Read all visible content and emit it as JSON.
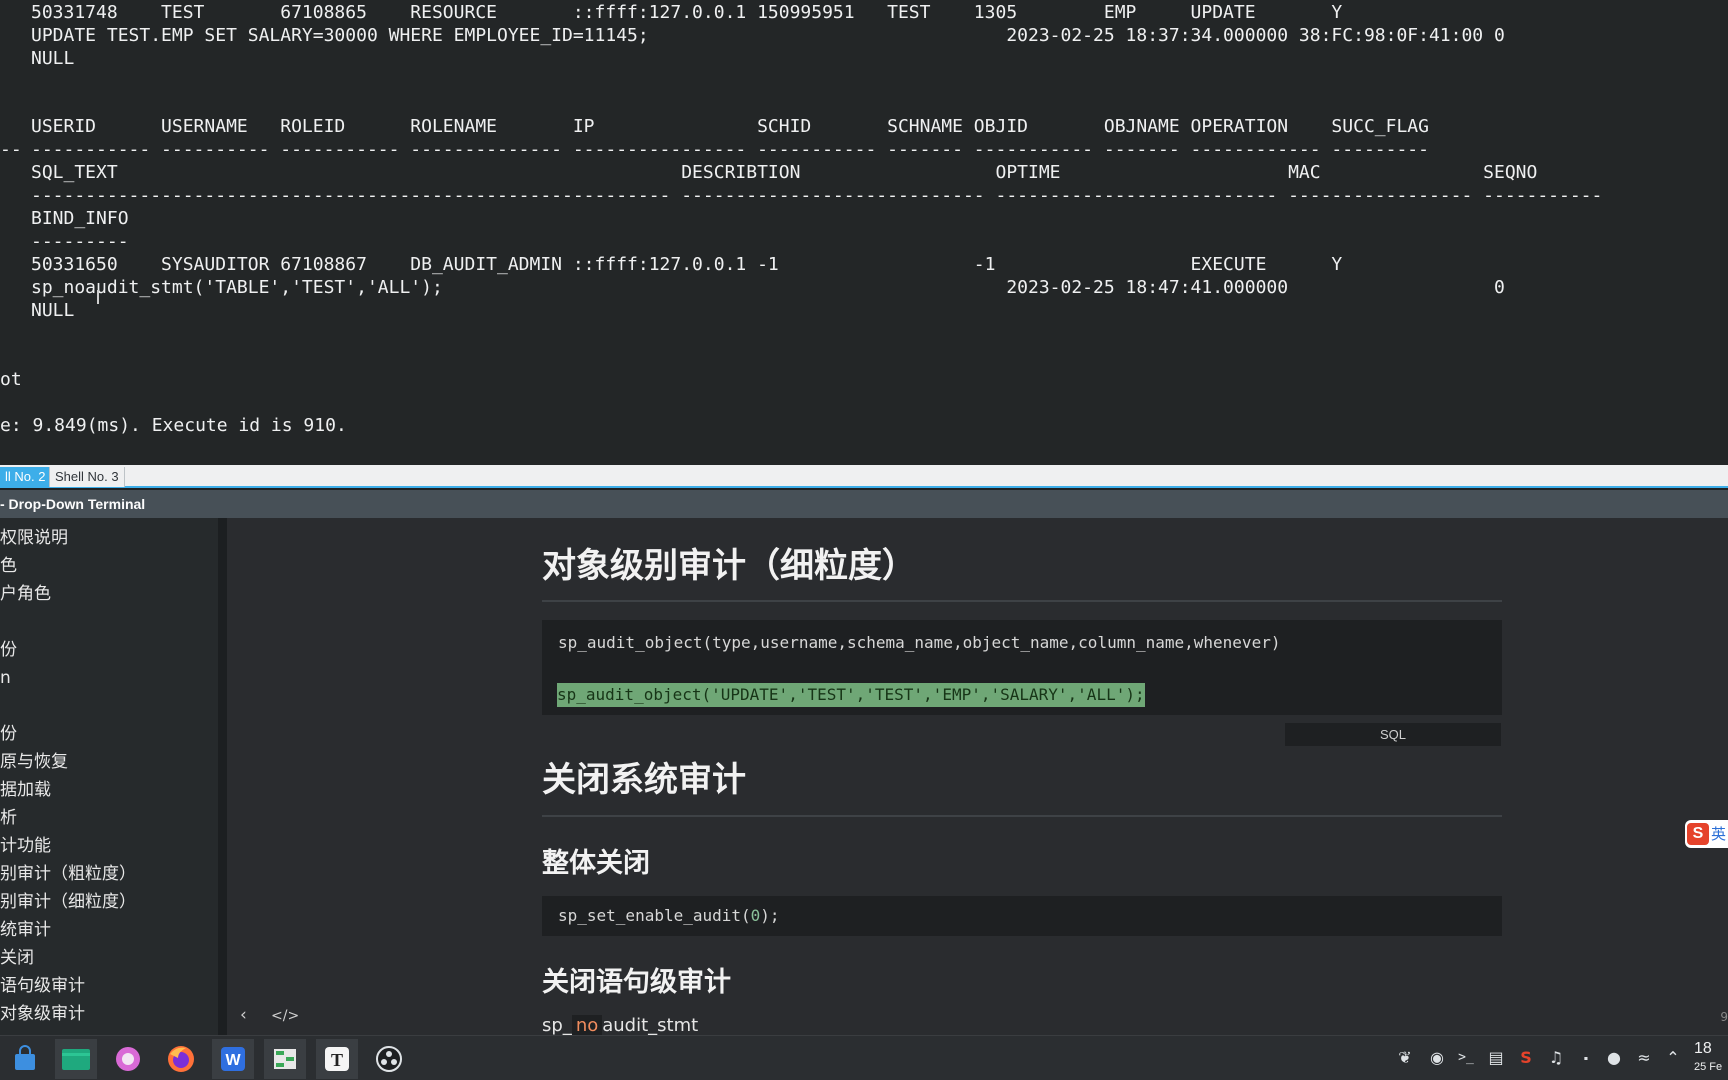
{
  "terminal": {
    "lines": [
      "50331748    TEST       67108865    RESOURCE       ::ffff:127.0.0.1 150995951   TEST    1305        EMP     UPDATE       Y",
      "UPDATE TEST.EMP SET SALARY=30000 WHERE EMPLOYEE_ID=11145;                                 2023-02-25 18:37:34.000000 38:FC:98:0F:41:00 0",
      "NULL",
      "USERID      USERNAME   ROLEID      ROLENAME       IP               SCHID       SCHNAME OBJID       OBJNAME OPERATION    SUCC_FLAG",
      "----------- ---------- ----------- -------------- ---------------- ----------- ------- ----------- ------- ------------ ---------",
      "SQL_TEXT                                                    DESCRIBTION                  OPTIME                     MAC               SEQNO",
      "----------------------------------------------------------- ---------------------------- -------------------------- ----------------- -----------",
      "BIND_INFO",
      "---------",
      "50331650    SYSAUDITOR 67108867    DB_AUDIT_ADMIN ::ffff:127.0.0.1 -1                  -1                  EXECUTE      Y",
      "sp_noaudit_stmt('TABLE','TEST','ALL');                                                    2023-02-25 18:47:41.000000                   0",
      "NULL",
      "ot",
      "e: 9.849(ms). Execute id is 910."
    ],
    "dash_prefix": "--"
  },
  "tabs": [
    {
      "label": "ll No. 2"
    },
    {
      "label": "Shell No. 3"
    }
  ],
  "window_title": "- Drop-Down Terminal",
  "sidebar": {
    "items": [
      "权限说明",
      "色",
      "户角色",
      "份",
      "n",
      "份",
      "原与恢复",
      "据加载",
      "析",
      "计功能",
      "别审计（粗粒度）",
      "别审计（细粒度）",
      "统审计",
      "关闭",
      "语句级审计",
      "对象级审计"
    ]
  },
  "doc": {
    "h1_object_audit": "对象级别审计（细粒度）",
    "code1_line1": "sp_audit_object(type,username,schema_name,object_name,column_name,whenever)",
    "code1_line2": "sp_audit_object('UPDATE','TEST','TEST','EMP','SALARY','ALL');",
    "code_lang": "SQL",
    "h1_close_audit": "关闭系统审计",
    "h2_close_all": "整体关闭",
    "code2_prefix": "sp_set_enable_audit(",
    "code2_num": "0",
    "code2_suffix": ");",
    "h2_close_stmt": "关闭语句级审计",
    "inline_code_a": "sp_",
    "inline_code_no": "no",
    "inline_code_b": "audit_stmt",
    "right_marker": "9"
  },
  "sogou": {
    "s": "S",
    "lang": "英"
  },
  "clock": {
    "time": "18",
    "date": "25 Fe"
  }
}
